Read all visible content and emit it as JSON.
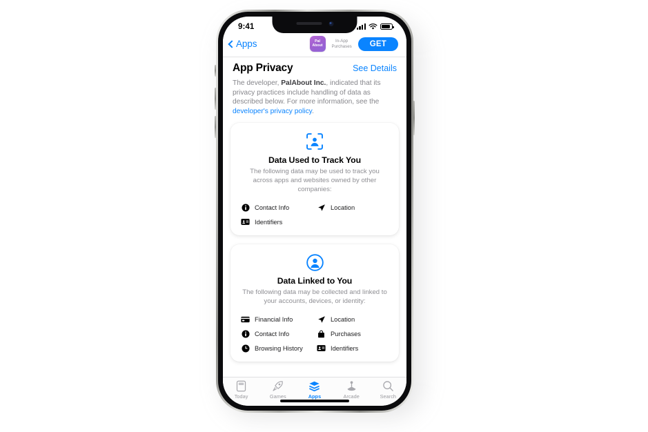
{
  "status_bar": {
    "time": "9:41",
    "signal_icon": "cellular-bars-icon",
    "wifi_icon": "wifi-icon",
    "battery_icon": "battery-icon"
  },
  "nav": {
    "back_label": "Apps",
    "back_icon": "chevron-left-icon",
    "app_icon_line1": "Pal",
    "app_icon_line2": "About",
    "in_app_purchases_line1": "In-App",
    "in_app_purchases_line2": "Purchases",
    "get_label": "GET"
  },
  "header": {
    "title": "App Privacy",
    "see_details_label": "See Details",
    "intro_part1": "The developer, ",
    "intro_developer": "PalAbout Inc.",
    "intro_part2": ", indicated that its privacy practices include handling of data as described below. For more information, see the ",
    "intro_link": "developer's privacy policy",
    "intro_part3": "."
  },
  "cards": [
    {
      "icon": "track-you-icon",
      "title": "Data Used to Track You",
      "subtitle": "The following data may be used to track you across apps and websites owned by other companies:",
      "items": [
        {
          "label": "Contact Info",
          "icon": "info-circle-icon"
        },
        {
          "label": "Location",
          "icon": "location-arrow-icon"
        },
        {
          "label": "Identifiers",
          "icon": "id-card-icon"
        }
      ]
    },
    {
      "icon": "person-circle-icon",
      "title": "Data Linked to You",
      "subtitle": "The following data may be collected and linked to your accounts, devices, or identity:",
      "items": [
        {
          "label": "Financial Info",
          "icon": "credit-card-icon"
        },
        {
          "label": "Location",
          "icon": "location-arrow-icon"
        },
        {
          "label": "Contact Info",
          "icon": "info-circle-icon"
        },
        {
          "label": "Purchases",
          "icon": "shopping-bag-icon"
        },
        {
          "label": "Browsing History",
          "icon": "clock-icon"
        },
        {
          "label": "Identifiers",
          "icon": "id-card-icon"
        }
      ]
    }
  ],
  "tabbar": [
    {
      "label": "Today",
      "icon": "today-card-icon",
      "active": false
    },
    {
      "label": "Games",
      "icon": "rocket-icon",
      "active": false
    },
    {
      "label": "Apps",
      "icon": "layers-icon",
      "active": true
    },
    {
      "label": "Arcade",
      "icon": "joystick-icon",
      "active": false
    },
    {
      "label": "Search",
      "icon": "magnifier-icon",
      "active": false
    }
  ],
  "colors": {
    "accent": "#0a84ff",
    "secondary_text": "#8e8e93",
    "background": "#ffffff"
  }
}
